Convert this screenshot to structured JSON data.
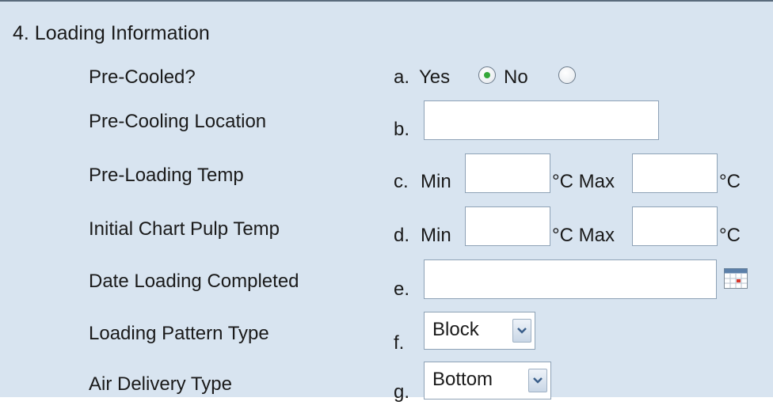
{
  "section": {
    "title": "4. Loading Information"
  },
  "rows": {
    "pre_cooled": {
      "label": "Pre-Cooled?",
      "letter": "a.",
      "yes_label": "Yes",
      "no_label": "No",
      "selected": "Yes"
    },
    "pre_cooling_location": {
      "label": "Pre-Cooling Location",
      "letter": "b.",
      "value": ""
    },
    "pre_loading_temp": {
      "label": "Pre-Loading Temp",
      "letter": "c.",
      "min_label": "Min",
      "max_label": "°C Max",
      "unit_label": "°C",
      "min_value": "",
      "max_value": ""
    },
    "initial_chart_pulp_temp": {
      "label": "Initial Chart Pulp Temp",
      "letter": "d.",
      "min_label": "Min",
      "max_label": "°C Max",
      "unit_label": "°C",
      "min_value": "",
      "max_value": ""
    },
    "date_loading_completed": {
      "label": "Date Loading Completed",
      "letter": "e.",
      "value": "",
      "icon": "calendar-icon"
    },
    "loading_pattern_type": {
      "label": "Loading Pattern Type",
      "letter": "f.",
      "selected": "Block"
    },
    "air_delivery_type": {
      "label": "Air Delivery Type",
      "letter": "g.",
      "selected": "Bottom"
    }
  },
  "colors": {
    "panel_bg": "#d8e4f0",
    "radio_selected": "#35a83a",
    "input_border": "#8ea2b6"
  }
}
